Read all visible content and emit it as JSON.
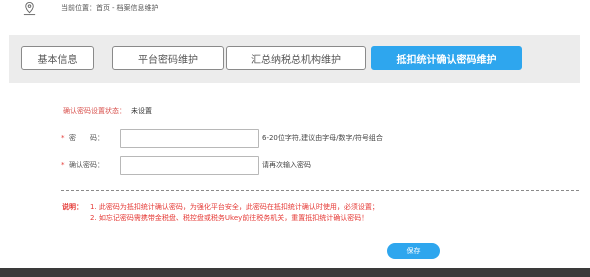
{
  "breadcrumb": {
    "prefix": "当前位置：",
    "home": "首页",
    "separator": "-",
    "current": "档案信息维护"
  },
  "tabs": [
    {
      "label": "基本信息",
      "active": false
    },
    {
      "label": "平台密码维护",
      "active": false
    },
    {
      "label": "汇总纳税总机构维护",
      "active": false
    },
    {
      "label": "抵扣统计确认密码维护",
      "active": true
    }
  ],
  "status": {
    "label": "确认密码设置状态：",
    "value": "未设置"
  },
  "fields": {
    "password": {
      "label": "密　　码：",
      "value": "",
      "hint": "6-20位字符,建议由字母/数字/符号组合"
    },
    "confirm": {
      "label": "确认密码：",
      "value": "",
      "hint": "请再次输入密码"
    }
  },
  "required_mark": "*",
  "note": {
    "label": "说明：",
    "lines": [
      "1. 此密码为抵扣统计确认密码，为强化平台安全，此密码在抵扣统计确认时使用，必须设置；",
      "2. 如忘记密码需携带金税盘、税控盘或税务Ukey前往税务机关，重置抵扣统计确认密码！"
    ]
  },
  "save_label": "保存",
  "colors": {
    "accent": "#2ea6ee",
    "warning": "#e53935",
    "tabbar": "#ececec"
  }
}
